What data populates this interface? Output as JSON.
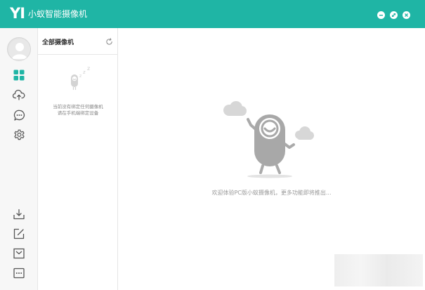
{
  "titlebar": {
    "logo": "YI",
    "app_title": "小蚁智能摄像机"
  },
  "window_controls": [
    "minimize-icon",
    "restore-icon",
    "close-icon"
  ],
  "nav": {
    "items": [
      {
        "name": "grid-icon",
        "active": true
      },
      {
        "name": "upload-cloud-icon"
      },
      {
        "name": "chat-bubble-icon"
      },
      {
        "name": "gear-icon"
      }
    ],
    "bottom_items": [
      {
        "name": "download-icon"
      },
      {
        "name": "edit-icon"
      },
      {
        "name": "mail-icon"
      },
      {
        "name": "more-icon"
      }
    ]
  },
  "camera_list": {
    "title": "全部摄像机",
    "empty_line1": "当前没有绑定任何摄像机",
    "empty_line2": "请在手机端绑定设备"
  },
  "main": {
    "welcome": "欢迎体验PC版小蚁摄像机，更多功能即将推出..."
  },
  "colors": {
    "accent": "#1fb5a5",
    "active_icon": "#1fb5a5",
    "icon": "#555555",
    "mascot": "#a8a8a8"
  }
}
